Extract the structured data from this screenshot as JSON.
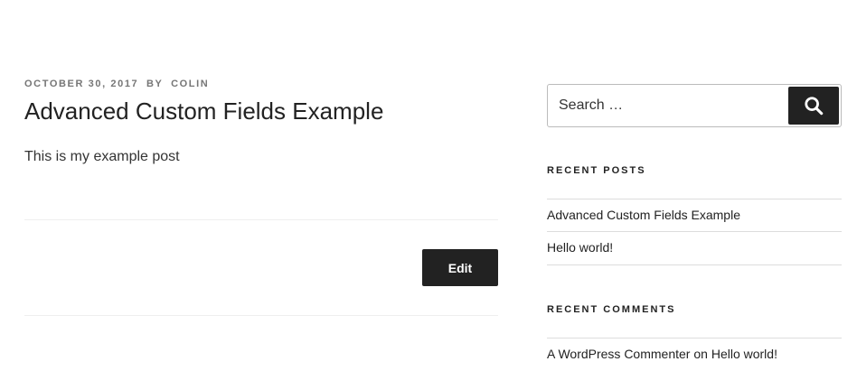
{
  "post": {
    "date": "OCTOBER 30, 2017",
    "by": "BY",
    "author": "COLIN",
    "title": "Advanced Custom Fields Example",
    "content": "This is my example post",
    "edit_label": "Edit"
  },
  "sidebar": {
    "search": {
      "placeholder": "Search …",
      "submit_icon": "search-icon"
    },
    "recent_posts": {
      "title": "RECENT POSTS",
      "items": [
        {
          "label": "Advanced Custom Fields Example"
        },
        {
          "label": "Hello world!"
        }
      ]
    },
    "recent_comments": {
      "title": "RECENT COMMENTS",
      "items": [
        {
          "author": "A WordPress Commenter",
          "on": "on",
          "post": "Hello world!"
        }
      ]
    }
  },
  "colors": {
    "button_bg": "#222222",
    "meta_text": "#767676",
    "divider": "#eeeeee"
  }
}
